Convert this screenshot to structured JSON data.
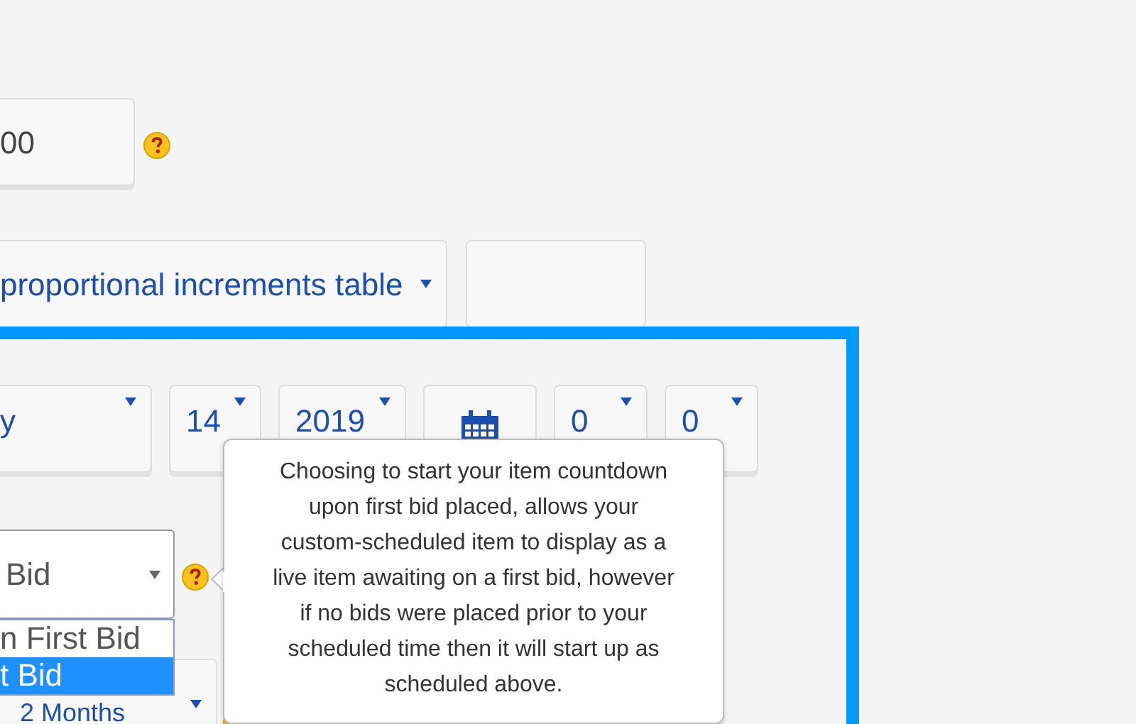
{
  "price_field": {
    "value": "00"
  },
  "increment_select": {
    "value": "proportional increments table"
  },
  "schedule": [
    {
      "kind": "select",
      "value": "y"
    },
    {
      "kind": "select",
      "value": "14"
    },
    {
      "kind": "select",
      "value": "2019"
    },
    {
      "kind": "calendar"
    },
    {
      "kind": "select",
      "value": "0"
    },
    {
      "kind": "select",
      "value": "0"
    }
  ],
  "start_select": {
    "value": "Bid",
    "options": [
      {
        "label": "n First Bid",
        "selected": false
      },
      {
        "label": "t Bid",
        "selected": true
      }
    ]
  },
  "duration_select": {
    "value": "2 Months"
  },
  "tooltip": {
    "text": "Choosing to start your item countdown upon first bid placed, allows your custom-scheduled item to display as a live item awaiting on a first bid, however if no bids were placed prior to your scheduled time then it will start up as scheduled above."
  }
}
